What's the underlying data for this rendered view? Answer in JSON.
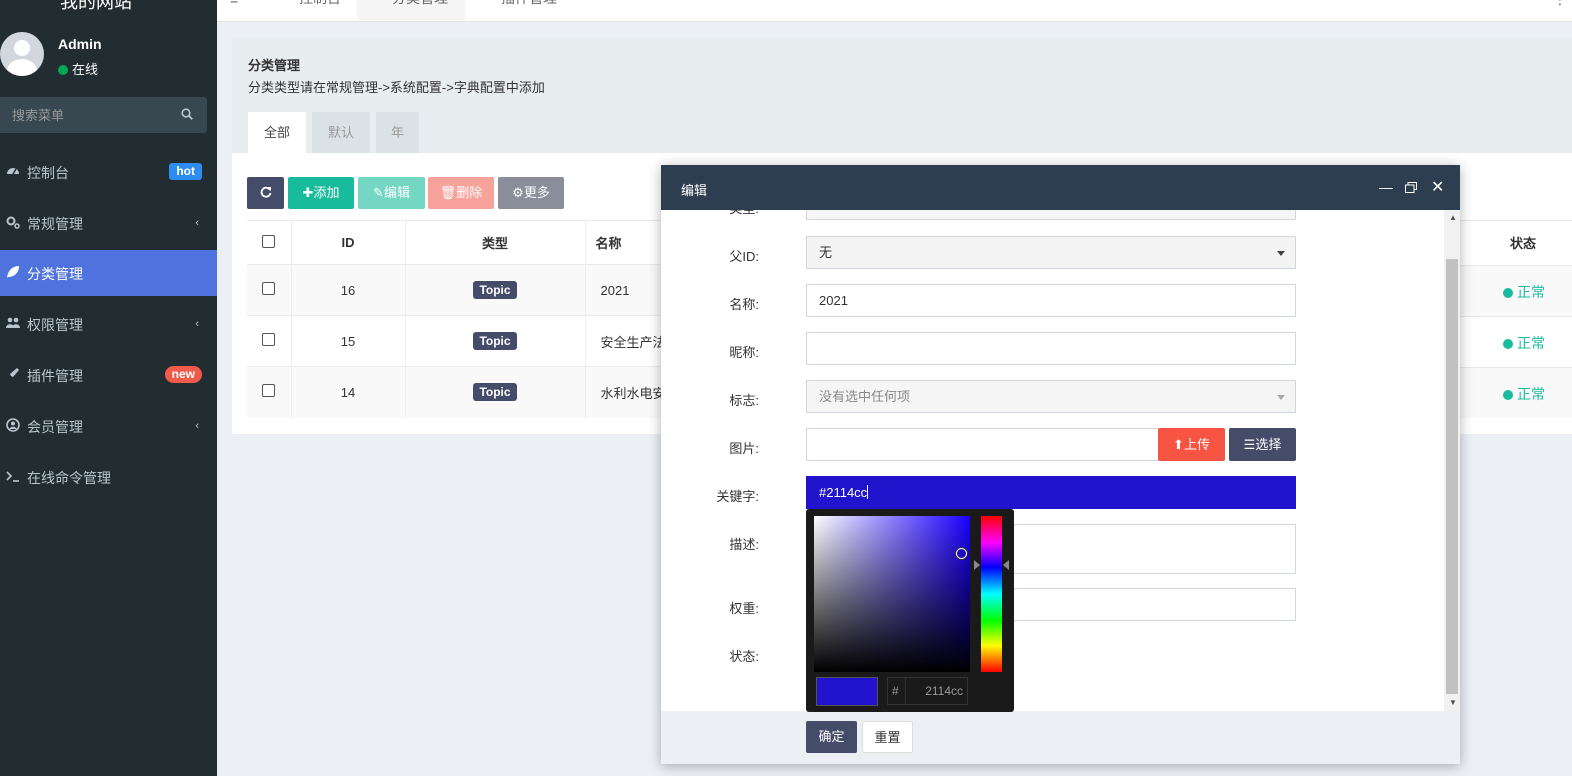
{
  "sidebar": {
    "site_title": "我的网站",
    "user_name": "Admin",
    "user_status": "在线",
    "search_placeholder": "搜索菜单",
    "items": [
      {
        "label": "控制台",
        "badge": "hot"
      },
      {
        "label": "常规管理"
      },
      {
        "label": "分类管理"
      },
      {
        "label": "权限管理"
      },
      {
        "label": "插件管理",
        "badge": "new"
      },
      {
        "label": "会员管理"
      },
      {
        "label": "在线命令管理"
      }
    ]
  },
  "topnav": {
    "tabs": [
      "控制台",
      "分类管理",
      "插件管理"
    ]
  },
  "panel": {
    "title": "分类管理",
    "desc": "分类类型请在常规管理->系统配置->字典配置中添加",
    "tabs": [
      "全部",
      "默认",
      "年"
    ]
  },
  "toolbar": {
    "add": "添加",
    "edit": "编辑",
    "delete": "删除",
    "more": "更多"
  },
  "table": {
    "headers": {
      "id": "ID",
      "type": "类型",
      "name": "名称",
      "status": "状态"
    },
    "rows": [
      {
        "id": "16",
        "type": "Topic",
        "name": "2021",
        "status": "正常"
      },
      {
        "id": "15",
        "type": "Topic",
        "name": "安全生产法",
        "status": "正常"
      },
      {
        "id": "14",
        "type": "Topic",
        "name": "水利水电安",
        "status": "正常"
      }
    ]
  },
  "modal": {
    "title": "编辑",
    "labels": {
      "type": "类型:",
      "pid": "父ID:",
      "name": "名称:",
      "nickname": "昵称:",
      "flag": "标志:",
      "image": "图片:",
      "keywords": "关键字:",
      "description": "描述:",
      "weigh": "权重:",
      "status": "状态:"
    },
    "values": {
      "pid": "无",
      "name": "2021",
      "nickname": "",
      "flag_placeholder": "没有选中任何项",
      "image": "",
      "keywords": "#2114cc"
    },
    "buttons": {
      "upload": "上传",
      "choose": "选择",
      "confirm": "确定",
      "reset": "重置"
    },
    "picker": {
      "hash": "#",
      "hex": "2114cc",
      "color": "#2114cc"
    }
  },
  "colors": {
    "sidebar_bg": "#222d32",
    "active_menu": "#4e73df",
    "success": "#18bc9c",
    "danger": "#f75444",
    "primary_dark": "#444c69",
    "modal_header": "#2c3e50",
    "picked": "#2114cc"
  }
}
